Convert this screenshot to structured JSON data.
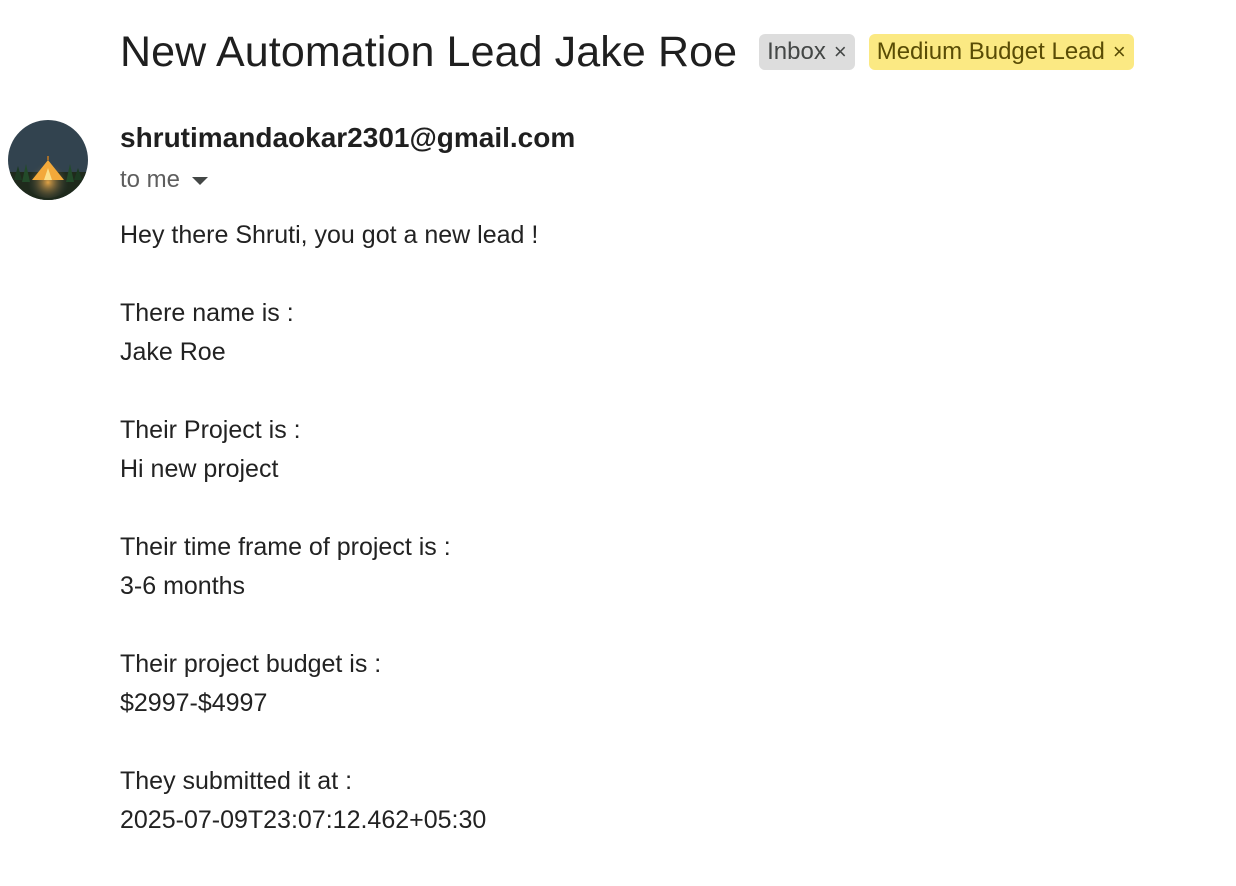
{
  "email": {
    "subject": "New Automation Lead Jake Roe",
    "labels": [
      {
        "name": "Inbox",
        "close": "×",
        "color": "#dddddd"
      },
      {
        "name": "Medium Budget Lead",
        "close": "×",
        "color": "#fbe983"
      }
    ],
    "sender": "shrutimandaokar2301@gmail.com",
    "recipient": "to me",
    "avatar_icon": "camping-tent-avatar",
    "body": {
      "greeting": "Hey there Shruti, you got a new lead !",
      "name_label": "There name is :",
      "name_value": "Jake Roe",
      "project_label": "Their Project is :",
      "project_value": "Hi new project",
      "timeframe_label": "Their time frame of project is :",
      "timeframe_value": "3-6 months",
      "budget_label": "Their project budget is :",
      "budget_value": "$2997-$4997",
      "submitted_label": "They submitted it at :",
      "submitted_value": "2025-07-09T23:07:12.462+05:30"
    }
  }
}
